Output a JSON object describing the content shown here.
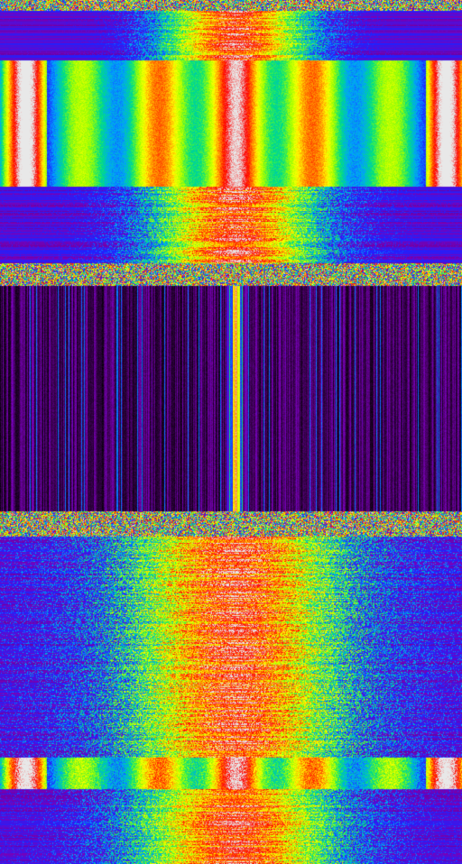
{
  "spectrogram": {
    "palette": [
      "#000000",
      "#3a0050",
      "#7a00b8",
      "#2020ff",
      "#00a0ff",
      "#00e080",
      "#a0ff00",
      "#ffff00",
      "#ff8000",
      "#ff0000",
      "#e8e8e8"
    ],
    "segments": [
      {
        "kind": "speckle",
        "rows": 12
      },
      {
        "kind": "band",
        "rows": 55,
        "form": "striated",
        "level_center": 1.0,
        "falloff": 0.4,
        "noise": 0.35
      },
      {
        "kind": "band",
        "rows": 140,
        "form": "harmonic",
        "level_center": 1.0,
        "period": 0.34,
        "noise": 0.08
      },
      {
        "kind": "band",
        "rows": 85,
        "form": "striated",
        "level_center": 1.0,
        "falloff": 0.45,
        "noise": 0.4
      },
      {
        "kind": "speckle",
        "rows": 25
      },
      {
        "kind": "quiet",
        "rows": 250,
        "carrier_level": 0.55,
        "floor": 0.12
      },
      {
        "kind": "speckle",
        "rows": 28
      },
      {
        "kind": "band",
        "rows": 245,
        "form": "striated",
        "level_center": 1.0,
        "falloff": 0.6,
        "noise": 0.45
      },
      {
        "kind": "band",
        "rows": 35,
        "form": "harmonic",
        "level_center": 1.0,
        "period": 0.34,
        "noise": 0.15
      },
      {
        "kind": "band",
        "rows": 83,
        "form": "striated",
        "level_center": 1.0,
        "falloff": 0.55,
        "noise": 0.4
      }
    ],
    "carrier_position": 0.51
  }
}
